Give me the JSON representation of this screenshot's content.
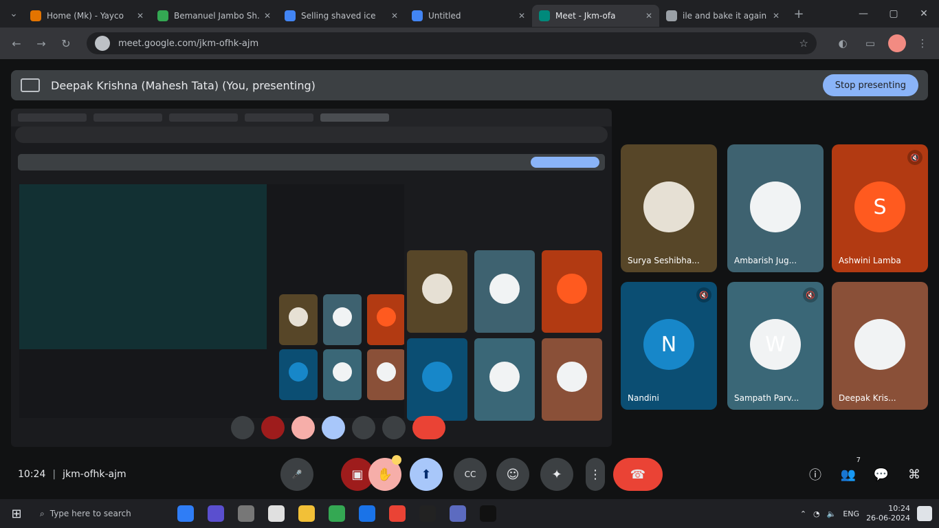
{
  "browser": {
    "tabs": [
      {
        "label": "Home (Mk) - Yayco",
        "favicon_color": "#e37400",
        "active": false
      },
      {
        "label": "Bemanuel Jambo Sh...",
        "favicon_color": "#34a853",
        "active": false
      },
      {
        "label": "Selling shaved ice",
        "favicon_color": "#4285f4",
        "active": false
      },
      {
        "label": "Untitled",
        "favicon_color": "#4285f4",
        "active": false
      },
      {
        "label": "Meet - Jkm-ofa",
        "favicon_color": "#00897b",
        "active": true
      },
      {
        "label": "ile and bake it again",
        "favicon_color": "#9aa0a6",
        "active": false
      }
    ],
    "address": "meet.google.com/jkm-ofhk-ajm",
    "icons": {
      "back": "back-arrow-icon",
      "forward": "forward-arrow-icon",
      "reload": "reload-icon",
      "star": "star-icon"
    }
  },
  "banner": {
    "title": "Deepak Krishna (Mahesh Tata) (You, presenting)",
    "stop_label": "Stop presenting"
  },
  "participants": [
    {
      "name": "Surya Seshibha...",
      "bg": "#574628",
      "avatar_bg": "#e6e0d4",
      "avatar_text": "",
      "muted": false
    },
    {
      "name": "Ambarish Jug...",
      "bg": "#3e6270",
      "avatar_bg": "#f1f3f4",
      "avatar_text": "",
      "muted": false
    },
    {
      "name": "Ashwini Lamba",
      "bg": "#b23a12",
      "avatar_bg": "#ff5a1f",
      "avatar_text": "S",
      "muted": true
    },
    {
      "name": "Nandini",
      "bg": "#0b4e73",
      "avatar_bg": "#1787c9",
      "avatar_text": "N",
      "muted": true
    },
    {
      "name": "Sampath Parv...",
      "bg": "#3a6777",
      "avatar_bg": "#f1f3f4",
      "avatar_text": "W",
      "muted": true
    },
    {
      "name": "Deepak Kris...",
      "bg": "#8a5038",
      "avatar_bg": "#f1f3f4",
      "avatar_text": "",
      "muted": false
    }
  ],
  "meeting": {
    "time": "10:24",
    "code": "jkm-ofhk-ajm"
  },
  "controls": [
    {
      "name": "mic-button",
      "icon": "mic-icon",
      "glyph": "🎤",
      "style": ""
    },
    {
      "name": "camera-button",
      "icon": "camera-icon",
      "glyph": "▣",
      "style": "red"
    },
    {
      "name": "hand-button",
      "icon": "hand-icon",
      "glyph": "✋",
      "style": "pink"
    },
    {
      "name": "present-button",
      "icon": "present-icon",
      "glyph": "⬆",
      "style": "blue"
    },
    {
      "name": "captions-button",
      "icon": "captions-icon",
      "glyph": "CC",
      "style": ""
    },
    {
      "name": "reactions-button",
      "icon": "emoji-icon",
      "glyph": "☺",
      "style": ""
    },
    {
      "name": "effects-button",
      "icon": "effects-icon",
      "glyph": "✦",
      "style": ""
    },
    {
      "name": "more-button",
      "icon": "more-vert-icon",
      "glyph": "⋮",
      "style": ""
    },
    {
      "name": "leave-call-button",
      "icon": "call-end-icon",
      "glyph": "☎",
      "style": "end"
    }
  ],
  "side_controls": [
    {
      "name": "info-button",
      "icon": "info-icon",
      "glyph": "ⓘ"
    },
    {
      "name": "people-button",
      "icon": "people-icon",
      "glyph": "👥",
      "count": "7"
    },
    {
      "name": "chat-button",
      "icon": "chat-icon",
      "glyph": "💬"
    },
    {
      "name": "activities-button",
      "icon": "activities-icon",
      "glyph": "⌘"
    }
  ],
  "taskbar": {
    "search_placeholder": "Type here to search",
    "apps": [
      "#2f7df6",
      "#5a4fcf",
      "#777777",
      "#e0e0e0",
      "#f2c037",
      "#34a853",
      "#1a73e8",
      "#ea4335",
      "#222222",
      "#5c6bc0",
      "#111111"
    ],
    "tray_temp": "ENG",
    "clock_time": "10:24",
    "clock_date": "26-06-2024"
  }
}
